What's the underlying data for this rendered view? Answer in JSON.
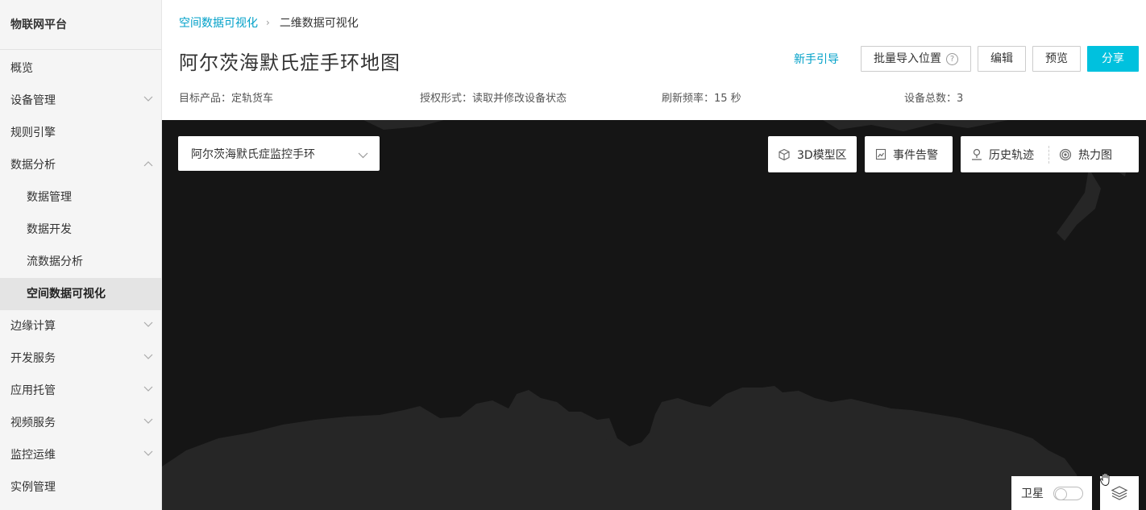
{
  "sidebar": {
    "brand": "物联网平台",
    "items": [
      {
        "label": "概览"
      },
      {
        "label": "设备管理"
      },
      {
        "label": "规则引擎"
      },
      {
        "label": "数据分析"
      },
      {
        "label": "数据管理"
      },
      {
        "label": "数据开发"
      },
      {
        "label": "流数据分析"
      },
      {
        "label": "空间数据可视化"
      },
      {
        "label": "边缘计算"
      },
      {
        "label": "开发服务"
      },
      {
        "label": "应用托管"
      },
      {
        "label": "视频服务"
      },
      {
        "label": "监控运维"
      },
      {
        "label": "实例管理"
      }
    ]
  },
  "breadcrumb": {
    "parent": "空间数据可视化",
    "current": "二维数据可视化"
  },
  "page": {
    "title": "阿尔茨海默氏症手环地图"
  },
  "actions": {
    "guide": "新手引导",
    "import": "批量导入位置",
    "help": "?",
    "edit": "编辑",
    "preview": "预览",
    "share": "分享"
  },
  "meta": {
    "product": "目标产品：定轨货车",
    "auth": "授权形式：读取并修改设备状态",
    "refresh": "刷新频率：15 秒",
    "total": "设备总数：3"
  },
  "map": {
    "device_select": "阿尔茨海默氏症监控手环",
    "model_zone": "3D模型区",
    "event_alarm": "事件告警",
    "history_track": "历史轨迹",
    "heatmap": "热力图",
    "satellite": "卫星"
  },
  "colors": {
    "accent": "#00c1de",
    "link": "#00a0c8",
    "map_bg": "#151515",
    "land": "#262626",
    "sidebar_bg": "#f5f5f5"
  }
}
